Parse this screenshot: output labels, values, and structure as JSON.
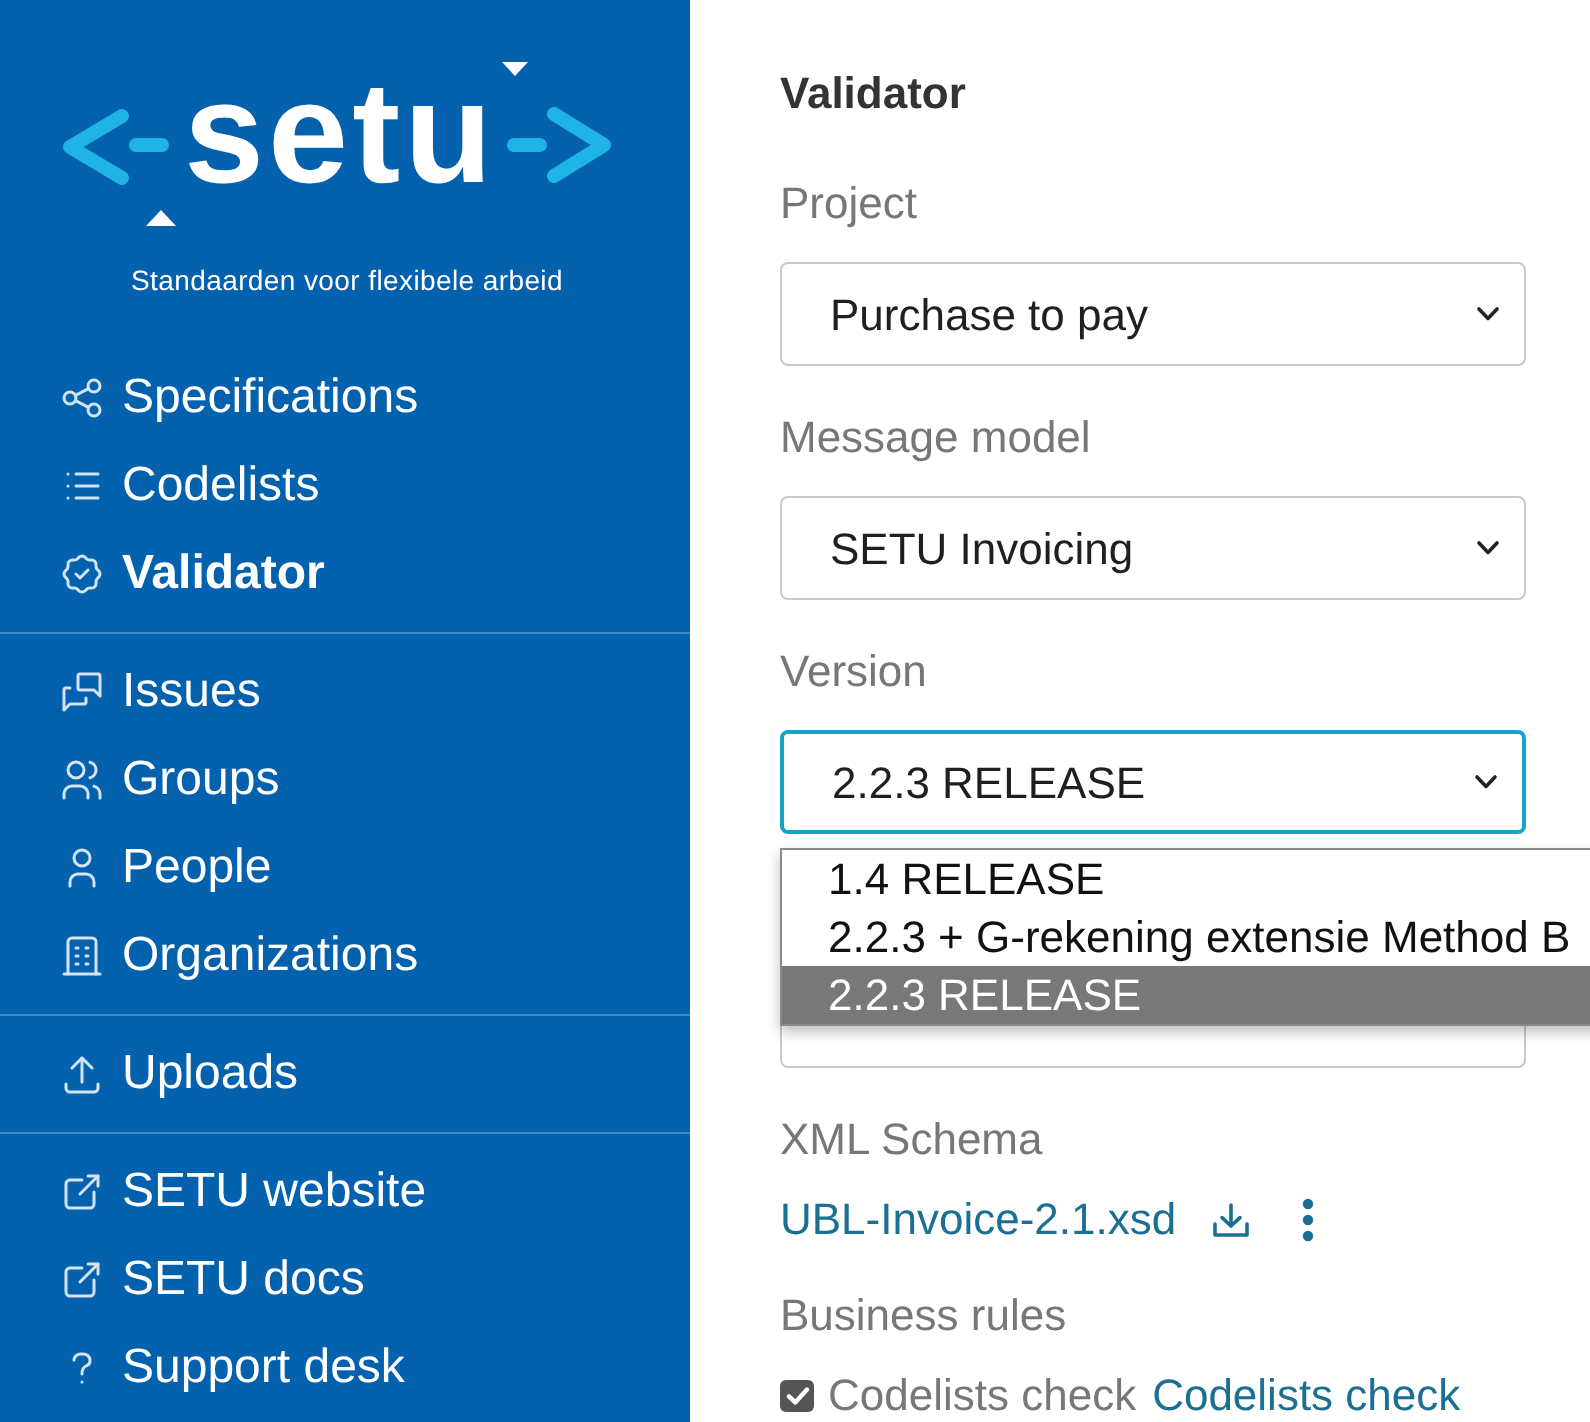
{
  "sidebar": {
    "logo": {
      "wordmark": "setu",
      "tagline": "Standaarden voor flexibele arbeid"
    },
    "nav_groups": [
      {
        "items": [
          {
            "label": "Specifications",
            "selected": false
          },
          {
            "label": "Codelists",
            "selected": false
          },
          {
            "label": "Validator",
            "selected": true
          }
        ]
      },
      {
        "items": [
          {
            "label": "Issues",
            "selected": false
          },
          {
            "label": "Groups",
            "selected": false
          },
          {
            "label": "People",
            "selected": false
          },
          {
            "label": "Organizations",
            "selected": false
          }
        ]
      },
      {
        "items": [
          {
            "label": "Uploads",
            "selected": false
          }
        ]
      },
      {
        "items": [
          {
            "label": "SETU website",
            "selected": false
          },
          {
            "label": "SETU docs",
            "selected": false
          },
          {
            "label": "Support desk",
            "selected": false
          }
        ]
      }
    ]
  },
  "main": {
    "title": "Validator",
    "fields": [
      {
        "kind": "select",
        "label": "Project",
        "value": "Purchase to pay",
        "focused": false
      },
      {
        "kind": "select",
        "label": "Message model",
        "value": "SETU Invoicing",
        "focused": false
      },
      {
        "kind": "select",
        "label": "Version",
        "value": "2.2.3 RELEASE",
        "focused": true,
        "open": true,
        "options": [
          {
            "label": "1.4 RELEASE",
            "selected": false
          },
          {
            "label": "2.2.3 + G-rekening extensie Method B",
            "selected": false
          },
          {
            "label": "2.2.3 RELEASE",
            "selected": true
          }
        ]
      },
      {
        "kind": "select",
        "focused": false
      }
    ],
    "xml_schema": {
      "label": "XML Schema",
      "file": "UBL-Invoice-2.1.xsd"
    },
    "business_rules": {
      "label": "Business rules",
      "checks": [
        {
          "label": "Codelists check",
          "link": "Codelists check",
          "checked": true
        }
      ]
    }
  }
}
